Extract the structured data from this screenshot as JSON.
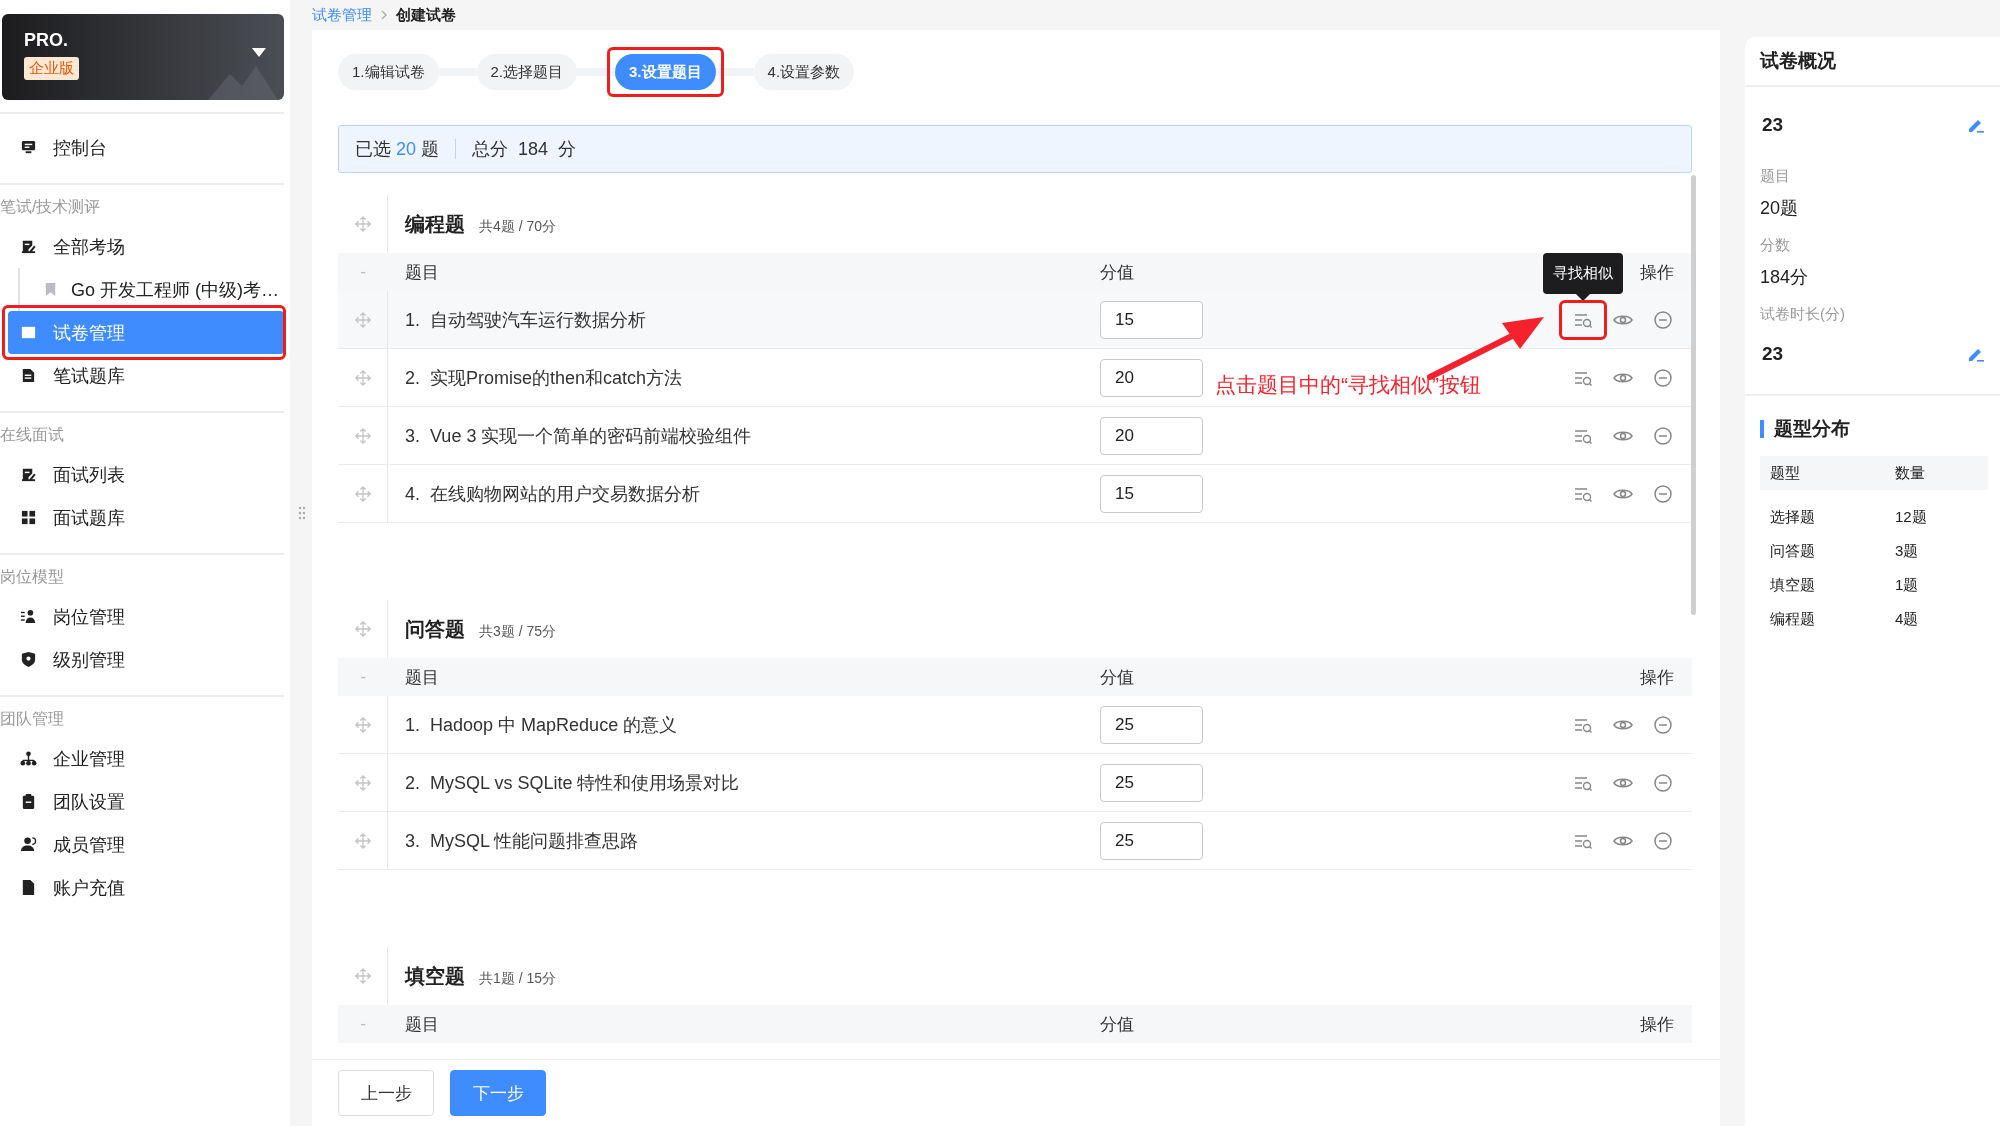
{
  "sidebar": {
    "brand": {
      "name": "PRO.",
      "badge": "企业版"
    },
    "groups": [
      {
        "items": [
          {
            "label": "控制台",
            "kind": "monitor",
            "selected": false,
            "annotated": false
          }
        ]
      },
      {
        "label": "笔试/技术测评",
        "items": [
          {
            "label": "全部考场",
            "kind": "exam",
            "selected": false,
            "annotated": false,
            "children": [
              {
                "label": "Go 开发工程师 (中级)考…",
                "kind": "bookmark",
                "selected": false,
                "annotated": false
              }
            ]
          },
          {
            "label": "试卷管理",
            "kind": "inbox",
            "selected": true,
            "annotated": true
          },
          {
            "label": "笔试题库",
            "kind": "doc",
            "selected": false,
            "annotated": false
          }
        ]
      },
      {
        "label": "在线面试",
        "items": [
          {
            "label": "面试列表",
            "kind": "exam",
            "selected": false,
            "annotated": false
          },
          {
            "label": "面试题库",
            "kind": "grid",
            "selected": false,
            "annotated": false
          }
        ]
      },
      {
        "label": "岗位模型",
        "items": [
          {
            "label": "岗位管理",
            "kind": "people",
            "selected": false,
            "annotated": false
          },
          {
            "label": "级别管理",
            "kind": "shield",
            "selected": false,
            "annotated": false
          }
        ]
      },
      {
        "label": "团队管理",
        "items": [
          {
            "label": "企业管理",
            "kind": "org",
            "selected": false,
            "annotated": false
          },
          {
            "label": "团队设置",
            "kind": "clipboard",
            "selected": false,
            "annotated": false
          },
          {
            "label": "成员管理",
            "kind": "user",
            "selected": false,
            "annotated": false
          },
          {
            "label": "账户充值",
            "kind": "file",
            "selected": false,
            "annotated": false
          }
        ]
      }
    ]
  },
  "breadcrumb": [
    "试卷管理",
    "创建试卷"
  ],
  "steps": [
    {
      "label": "1.编辑试卷",
      "selected": false,
      "annotated": false
    },
    {
      "label": "2.选择题目",
      "selected": false,
      "annotated": false
    },
    {
      "label": "3.设置题目",
      "selected": true,
      "annotated": true
    },
    {
      "label": "4.设置参数",
      "selected": false,
      "annotated": false
    }
  ],
  "summary": {
    "selected_prefix": "已选",
    "selected_count": "20",
    "selected_suffix": "题",
    "total": "总分  184  分"
  },
  "sections": [
    {
      "title": "编程题",
      "meta": "共4题 / 70分",
      "columns": [
        "-",
        "题目",
        "分值",
        "操作"
      ],
      "callout": "点击题目中的“寻找相似”按钮",
      "rows": [
        {
          "number": "1.",
          "title": "自动驾驶汽车运行数据分析",
          "score": "15",
          "highlighted": true,
          "tooltip": "寻找相似",
          "annotated": true
        },
        {
          "number": "2.",
          "title": "实现Promise的then和catch方法",
          "score": "20",
          "highlighted": false,
          "annotated": false
        },
        {
          "number": "3.",
          "title": "Vue 3 实现一个简单的密码前端校验组件",
          "score": "20",
          "highlighted": false,
          "annotated": false
        },
        {
          "number": "4.",
          "title": "在线购物网站的用户交易数据分析",
          "score": "15",
          "highlighted": false,
          "annotated": false
        }
      ]
    },
    {
      "title": "问答题",
      "meta": "共3题 / 75分",
      "columns": [
        "-",
        "题目",
        "分值",
        "操作"
      ],
      "rows": [
        {
          "number": "1.",
          "title": "Hadoop 中 MapReduce 的意义",
          "score": "25",
          "highlighted": false,
          "annotated": false
        },
        {
          "number": "2.",
          "title": "MySQL vs SQLite 特性和使用场景对比",
          "score": "25",
          "highlighted": false,
          "annotated": false
        },
        {
          "number": "3.",
          "title": "MySQL 性能问题排查思路",
          "score": "25",
          "highlighted": false,
          "annotated": false
        }
      ]
    },
    {
      "title": "填空题",
      "meta": "共1题 / 15分",
      "columns": [
        "-",
        "题目",
        "分值",
        "操作"
      ]
    }
  ],
  "footer": {
    "buttons": [
      {
        "label": "上一步",
        "kind": "default"
      },
      {
        "label": "下一步",
        "kind": "primary"
      }
    ]
  },
  "overview": {
    "title": "试卷概况",
    "fields": [
      {
        "value": "23",
        "editable": true
      },
      {
        "label": "题目",
        "value": "20题",
        "editable": false
      },
      {
        "label": "分数",
        "value": "184分",
        "editable": false
      },
      {
        "label": "试卷时长(分)",
        "value": "23",
        "editable": true
      }
    ]
  },
  "distribution": {
    "title": "题型分布",
    "columns": [
      "题型",
      "数量"
    ],
    "rows": [
      [
        "选择题",
        "12题"
      ],
      [
        "问答题",
        "3题"
      ],
      [
        "填空题",
        "1题"
      ],
      [
        "编程题",
        "4题"
      ]
    ]
  }
}
